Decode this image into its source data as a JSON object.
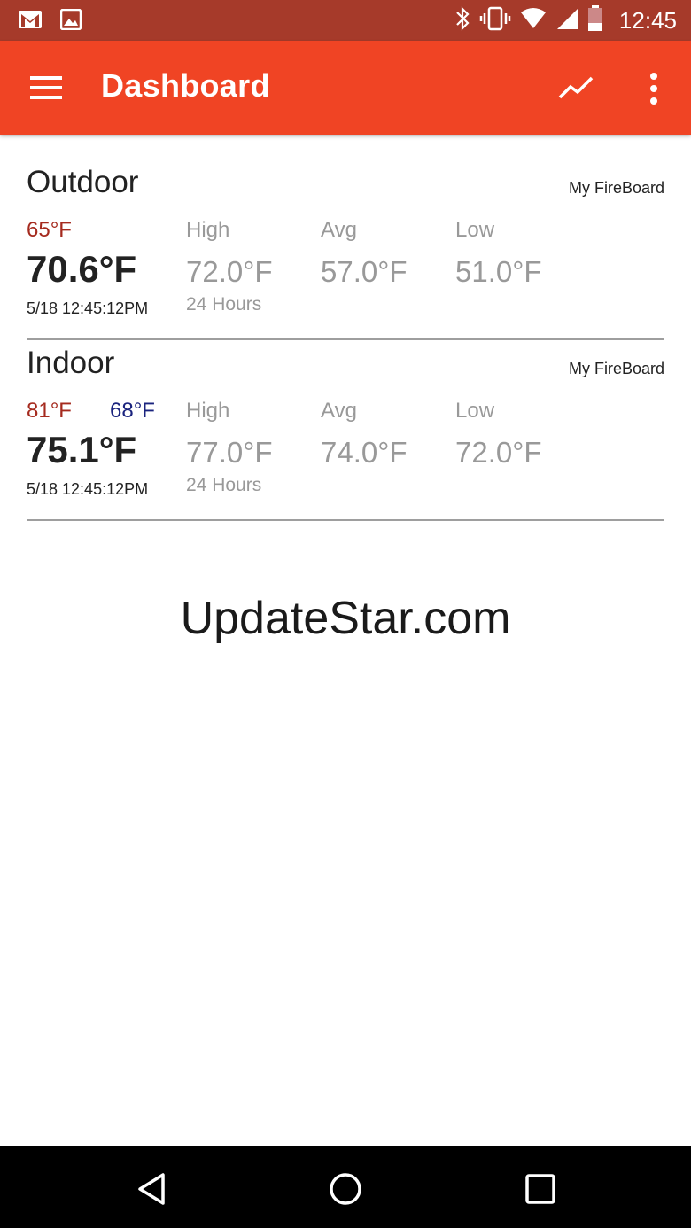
{
  "status_bar": {
    "time": "12:45",
    "left_icons": [
      "gmail-icon",
      "image-icon"
    ],
    "right_icons": [
      "bluetooth-icon",
      "vibrate-icon",
      "wifi-icon",
      "signal-icon",
      "battery-icon"
    ]
  },
  "app_bar": {
    "title": "Dashboard",
    "icons": [
      "menu-icon",
      "chart-icon",
      "more-vert-icon"
    ],
    "color": "#f04424"
  },
  "cards": [
    {
      "name": "Outdoor",
      "source": "My FireBoard",
      "alarm_high": "65°F",
      "alarm_low": "",
      "current": "70.6°F",
      "timestamp": "5/18 12:45:12PM",
      "high": {
        "label": "High",
        "value": "72.0°F",
        "sub": "24 Hours"
      },
      "avg": {
        "label": "Avg",
        "value": "57.0°F"
      },
      "low": {
        "label": "Low",
        "value": "51.0°F"
      }
    },
    {
      "name": "Indoor",
      "source": "My FireBoard",
      "alarm_high": "81°F",
      "alarm_low": "68°F",
      "current": "75.1°F",
      "timestamp": "5/18 12:45:12PM",
      "high": {
        "label": "High",
        "value": "77.0°F",
        "sub": "24 Hours"
      },
      "avg": {
        "label": "Avg",
        "value": "74.0°F"
      },
      "low": {
        "label": "Low",
        "value": "72.0°F"
      }
    }
  ],
  "watermark": "UpdateStar.com",
  "nav_bar": {
    "icons": [
      "back-icon",
      "home-icon",
      "recents-icon"
    ]
  }
}
